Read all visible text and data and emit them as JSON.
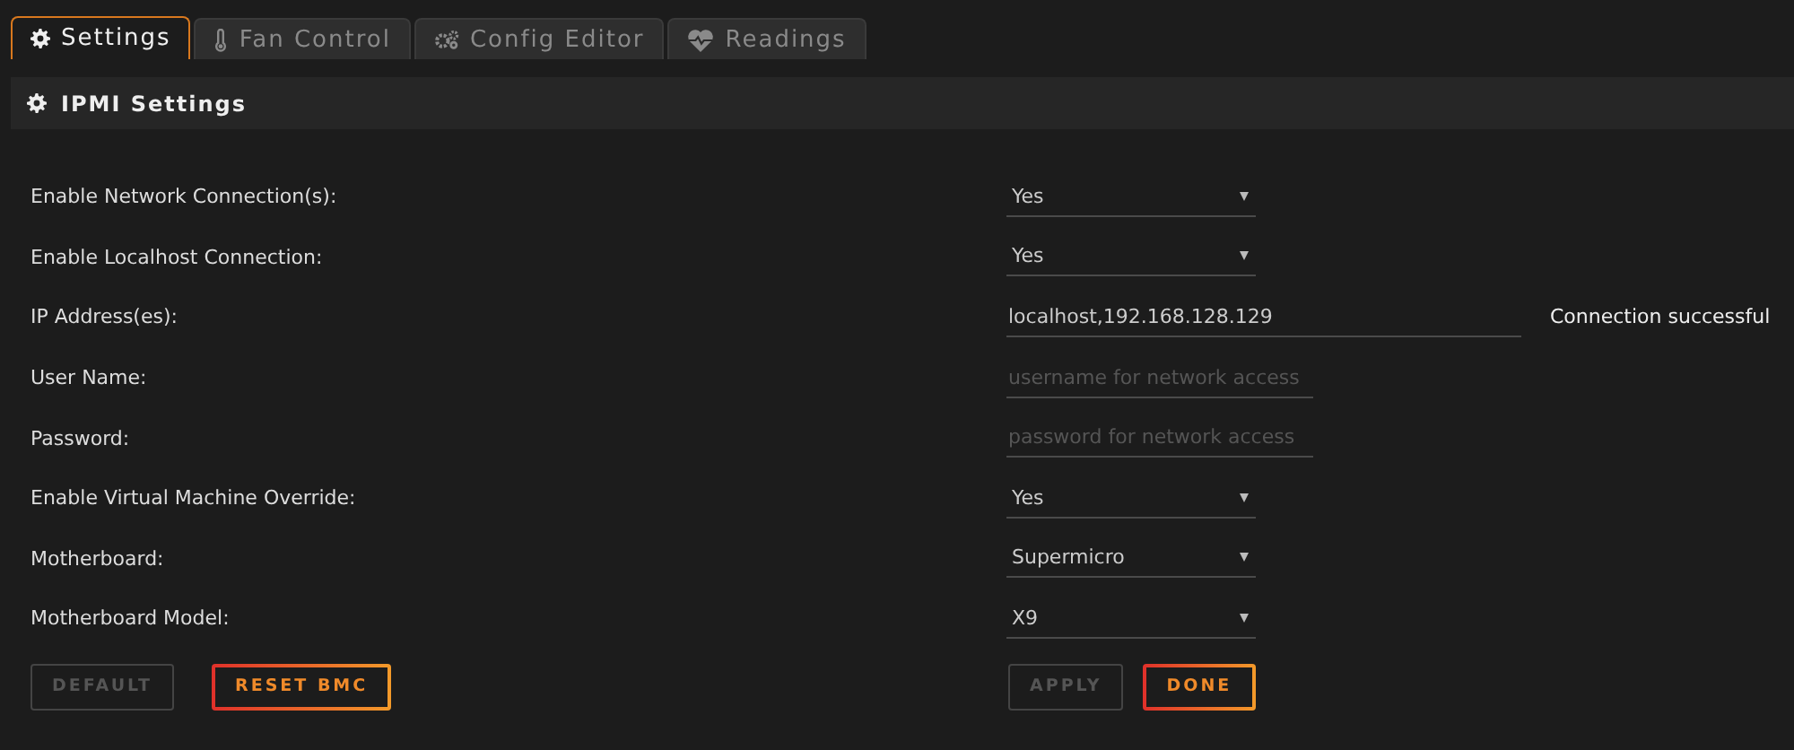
{
  "tabs": [
    {
      "label": "Settings",
      "selected": true
    },
    {
      "label": "Fan Control",
      "selected": false
    },
    {
      "label": "Config Editor",
      "selected": false
    },
    {
      "label": "Readings",
      "selected": false
    }
  ],
  "panel": {
    "title": "IPMI Settings"
  },
  "rows": [
    {
      "label": "Enable Network Connection(s):",
      "kind": "select",
      "value": "Yes"
    },
    {
      "label": "Enable Localhost Connection:",
      "kind": "select",
      "value": "Yes"
    },
    {
      "label": "IP Address(es):",
      "kind": "wide-text",
      "value": "localhost,192.168.128.129",
      "status": "Connection successful"
    },
    {
      "label": "User Name:",
      "kind": "text",
      "placeholder": "username for network access"
    },
    {
      "label": "Password:",
      "kind": "text",
      "placeholder": "password for network access"
    },
    {
      "label": "Enable Virtual Machine Override:",
      "kind": "select",
      "value": "Yes"
    },
    {
      "label": "Motherboard:",
      "kind": "select",
      "value": "Supermicro"
    },
    {
      "label": "Motherboard Model:",
      "kind": "select",
      "value": "X9"
    }
  ],
  "left_buttons": [
    {
      "label": "DEFAULT",
      "disabled": true
    },
    {
      "label": "RESET BMC",
      "disabled": false
    }
  ],
  "right_buttons": [
    {
      "label": "APPLY",
      "disabled": true
    },
    {
      "label": "DONE",
      "disabled": false
    }
  ]
}
